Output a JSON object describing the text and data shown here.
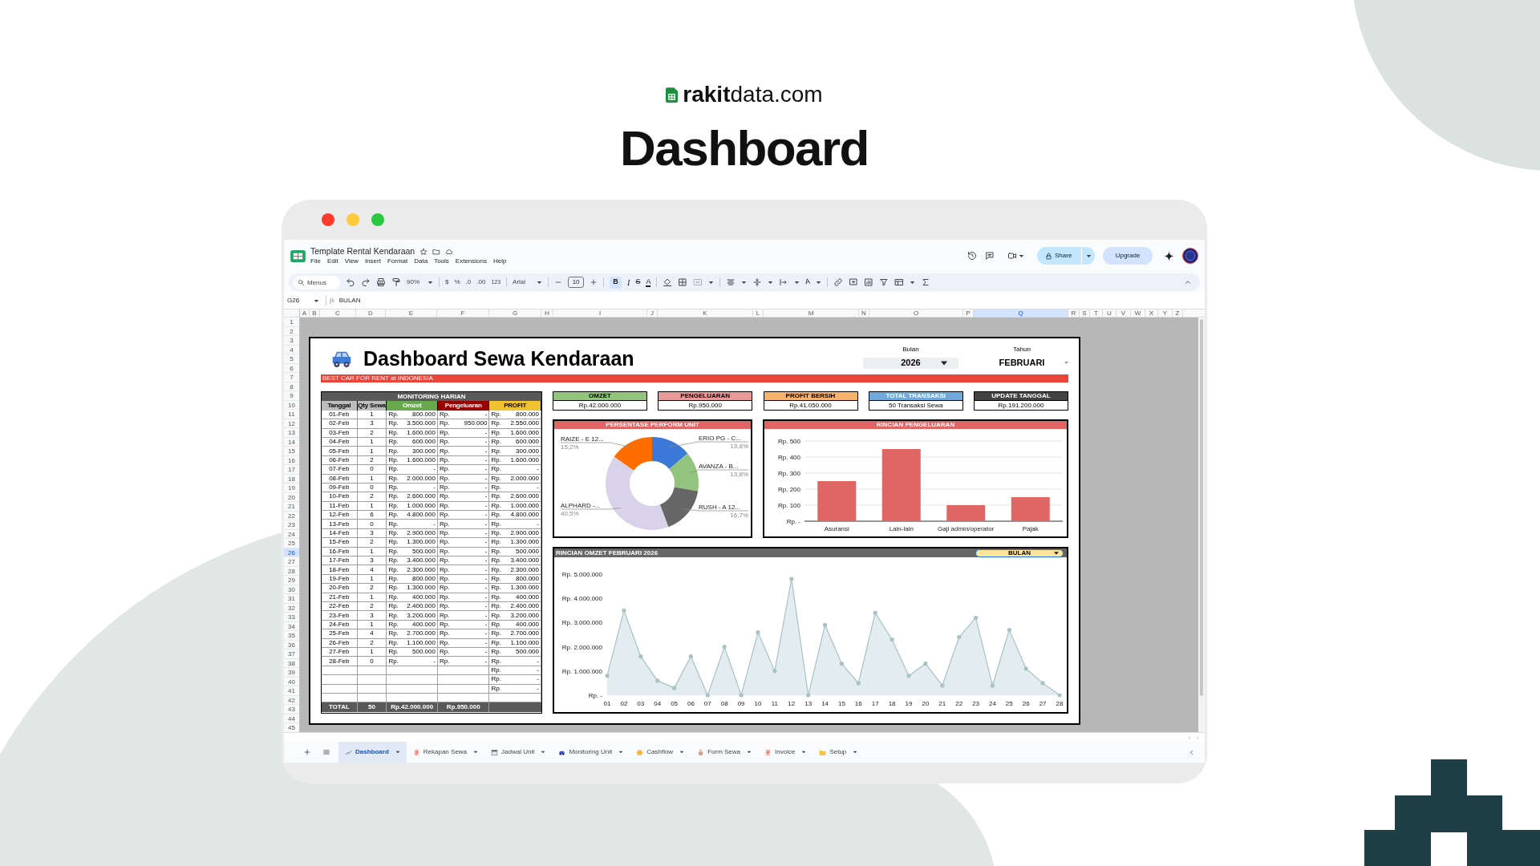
{
  "brand": "**rakit**data.com",
  "headline": "Dashboard",
  "sheets": {
    "doc_title": "Template Rental Kendaraan",
    "menu": [
      "File",
      "Edit",
      "View",
      "Insert",
      "Format",
      "Data",
      "Tools",
      "Extensions",
      "Help"
    ],
    "share": "Share",
    "upgrade": "Upgrade",
    "toolbar": {
      "search_placeholder": "Menus",
      "zoom": "90%",
      "currency": "$",
      "percent": "%",
      "decrease_decimals": ".0",
      "increase_decimals": ".00",
      "number_format": "123",
      "font": "Arial",
      "font_size": "10",
      "bold": "B",
      "bold_on": true,
      "italic": "I",
      "strike": "S",
      "text_color": "A",
      "rotate_text": "A"
    },
    "name_box": "G26",
    "fx": "fx",
    "formula": "BULAN",
    "columns": [
      {
        "label": "A",
        "selected": false
      },
      {
        "label": "B",
        "selected": false
      },
      {
        "label": "C",
        "selected": false
      },
      {
        "label": "D",
        "selected": false
      },
      {
        "label": "E",
        "selected": false
      },
      {
        "label": "F",
        "selected": false
      },
      {
        "label": "G",
        "selected": false
      },
      {
        "label": "H",
        "selected": false
      },
      {
        "label": "I",
        "selected": false
      },
      {
        "label": "J",
        "selected": false
      },
      {
        "label": "K",
        "selected": false
      },
      {
        "label": "L",
        "selected": false
      },
      {
        "label": "M",
        "selected": false
      },
      {
        "label": "N",
        "selected": false
      },
      {
        "label": "O",
        "selected": false
      },
      {
        "label": "P",
        "selected": false
      },
      {
        "label": "Q",
        "selected": true
      },
      {
        "label": "R",
        "selected": false
      },
      {
        "label": "S",
        "selected": false
      },
      {
        "label": "T",
        "selected": false
      },
      {
        "label": "U",
        "selected": false
      },
      {
        "label": "V",
        "selected": false
      },
      {
        "label": "W",
        "selected": false
      },
      {
        "label": "X",
        "selected": false
      },
      {
        "label": "Y",
        "selected": false
      },
      {
        "label": "Z",
        "selected": false
      }
    ],
    "rows": [
      {
        "label": "1",
        "selected": false
      },
      {
        "label": "2",
        "selected": false
      },
      {
        "label": "3",
        "selected": false
      },
      {
        "label": "4",
        "selected": false
      },
      {
        "label": "5",
        "selected": false
      },
      {
        "label": "6",
        "selected": false
      },
      {
        "label": "7",
        "selected": false
      },
      {
        "label": "8",
        "selected": false
      },
      {
        "label": "9",
        "selected": false
      },
      {
        "label": "10",
        "selected": false
      },
      {
        "label": "11",
        "selected": false
      },
      {
        "label": "12",
        "selected": false
      },
      {
        "label": "13",
        "selected": false
      },
      {
        "label": "14",
        "selected": false
      },
      {
        "label": "15",
        "selected": false
      },
      {
        "label": "16",
        "selected": false
      },
      {
        "label": "17",
        "selected": false
      },
      {
        "label": "18",
        "selected": false
      },
      {
        "label": "19",
        "selected": false
      },
      {
        "label": "20",
        "selected": false
      },
      {
        "label": "21",
        "selected": false
      },
      {
        "label": "22",
        "selected": false
      },
      {
        "label": "23",
        "selected": false
      },
      {
        "label": "24",
        "selected": false
      },
      {
        "label": "25",
        "selected": false
      },
      {
        "label": "26",
        "selected": true
      },
      {
        "label": "27",
        "selected": false
      },
      {
        "label": "28",
        "selected": false
      },
      {
        "label": "29",
        "selected": false
      },
      {
        "label": "30",
        "selected": false
      },
      {
        "label": "31",
        "selected": false
      },
      {
        "label": "32",
        "selected": false
      },
      {
        "label": "33",
        "selected": false
      },
      {
        "label": "34",
        "selected": false
      },
      {
        "label": "35",
        "selected": false
      },
      {
        "label": "36",
        "selected": false
      },
      {
        "label": "37",
        "selected": false
      },
      {
        "label": "38",
        "selected": false
      },
      {
        "label": "39",
        "selected": false
      },
      {
        "label": "40",
        "selected": false
      },
      {
        "label": "41",
        "selected": false
      },
      {
        "label": "42",
        "selected": false
      },
      {
        "label": "43",
        "selected": false
      },
      {
        "label": "44",
        "selected": false
      },
      {
        "label": "45",
        "selected": false
      }
    ],
    "tabs": [
      {
        "label": "Dashboard",
        "selected": true
      },
      {
        "label": "Rekapan Sewa",
        "selected": false
      },
      {
        "label": "Jadwal Unit",
        "selected": false
      },
      {
        "label": "Monitoring Unit",
        "selected": false
      },
      {
        "label": "Cashflow",
        "selected": false
      },
      {
        "label": "Form Sewa",
        "selected": false
      },
      {
        "label": "Invoice",
        "selected": false
      },
      {
        "label": "Setup",
        "selected": false
      }
    ]
  },
  "dashboard": {
    "title": "Dashboard Sewa Kendaraan",
    "tagline": "BEST CAR FOR RENT at INDONESIA",
    "year_label": "Bulan",
    "year": "2026",
    "month_label": "Tahun",
    "month": "FEBRUARI",
    "table": {
      "title": "MONITORING HARIAN",
      "columns": [
        {
          "label": "Tanggal",
          "color": "#bdbdbd"
        },
        {
          "label": "Qty Sewa",
          "color": "#bdbdbd"
        },
        {
          "label": "Omzet",
          "color": "#6aa84f"
        },
        {
          "label": "Pengeluaran",
          "color": "#990000"
        },
        {
          "label": "PROFIT",
          "color": "#f1c232"
        }
      ],
      "rows": [
        {
          "date": "01-Feb",
          "qty": "1",
          "omzet": [
            "Rp.",
            "800.000"
          ],
          "expense": [
            "Rp.",
            "-"
          ],
          "profit": [
            "Rp.",
            "800.000"
          ]
        },
        {
          "date": "02-Feb",
          "qty": "3",
          "omzet": [
            "Rp.",
            "3.500.000"
          ],
          "expense": [
            "Rp.",
            "950.000"
          ],
          "profit": [
            "Rp.",
            "2.550.000"
          ]
        },
        {
          "date": "03-Feb",
          "qty": "2",
          "omzet": [
            "Rp.",
            "1.600.000"
          ],
          "expense": [
            "Rp.",
            "-"
          ],
          "profit": [
            "Rp.",
            "1.600.000"
          ]
        },
        {
          "date": "04-Feb",
          "qty": "1",
          "omzet": [
            "Rp.",
            "600.000"
          ],
          "expense": [
            "Rp.",
            "-"
          ],
          "profit": [
            "Rp.",
            "600.000"
          ]
        },
        {
          "date": "05-Feb",
          "qty": "1",
          "omzet": [
            "Rp.",
            "300.000"
          ],
          "expense": [
            "Rp.",
            "-"
          ],
          "profit": [
            "Rp.",
            "300.000"
          ]
        },
        {
          "date": "06-Feb",
          "qty": "2",
          "omzet": [
            "Rp.",
            "1.600.000"
          ],
          "expense": [
            "Rp.",
            "-"
          ],
          "profit": [
            "Rp.",
            "1.600.000"
          ]
        },
        {
          "date": "07-Feb",
          "qty": "0",
          "omzet": [
            "Rp.",
            "-"
          ],
          "expense": [
            "Rp.",
            "-"
          ],
          "profit": [
            "Rp.",
            "-"
          ]
        },
        {
          "date": "08-Feb",
          "qty": "1",
          "omzet": [
            "Rp.",
            "2.000.000"
          ],
          "expense": [
            "Rp.",
            "-"
          ],
          "profit": [
            "Rp.",
            "2.000.000"
          ]
        },
        {
          "date": "09-Feb",
          "qty": "0",
          "omzet": [
            "Rp.",
            "-"
          ],
          "expense": [
            "Rp.",
            "-"
          ],
          "profit": [
            "Rp.",
            "-"
          ]
        },
        {
          "date": "10-Feb",
          "qty": "2",
          "omzet": [
            "Rp.",
            "2.600.000"
          ],
          "expense": [
            "Rp.",
            "-"
          ],
          "profit": [
            "Rp.",
            "2.600.000"
          ]
        },
        {
          "date": "11-Feb",
          "qty": "1",
          "omzet": [
            "Rp.",
            "1.000.000"
          ],
          "expense": [
            "Rp.",
            "-"
          ],
          "profit": [
            "Rp.",
            "1.000.000"
          ]
        },
        {
          "date": "12-Feb",
          "qty": "6",
          "omzet": [
            "Rp.",
            "4.800.000"
          ],
          "expense": [
            "Rp.",
            "-"
          ],
          "profit": [
            "Rp.",
            "4.800.000"
          ]
        },
        {
          "date": "13-Feb",
          "qty": "0",
          "omzet": [
            "Rp.",
            "-"
          ],
          "expense": [
            "Rp.",
            "-"
          ],
          "profit": [
            "Rp.",
            "-"
          ]
        },
        {
          "date": "14-Feb",
          "qty": "3",
          "omzet": [
            "Rp.",
            "2.900.000"
          ],
          "expense": [
            "Rp.",
            "-"
          ],
          "profit": [
            "Rp.",
            "2.900.000"
          ]
        },
        {
          "date": "15-Feb",
          "qty": "2",
          "omzet": [
            "Rp.",
            "1.300.000"
          ],
          "expense": [
            "Rp.",
            "-"
          ],
          "profit": [
            "Rp.",
            "1.300.000"
          ]
        },
        {
          "date": "16-Feb",
          "qty": "1",
          "omzet": [
            "Rp.",
            "500.000"
          ],
          "expense": [
            "Rp.",
            "-"
          ],
          "profit": [
            "Rp.",
            "500.000"
          ]
        },
        {
          "date": "17-Feb",
          "qty": "3",
          "omzet": [
            "Rp.",
            "3.400.000"
          ],
          "expense": [
            "Rp.",
            "-"
          ],
          "profit": [
            "Rp.",
            "3.400.000"
          ]
        },
        {
          "date": "18-Feb",
          "qty": "4",
          "omzet": [
            "Rp.",
            "2.300.000"
          ],
          "expense": [
            "Rp.",
            "-"
          ],
          "profit": [
            "Rp.",
            "2.300.000"
          ]
        },
        {
          "date": "19-Feb",
          "qty": "1",
          "omzet": [
            "Rp.",
            "800.000"
          ],
          "expense": [
            "Rp.",
            "-"
          ],
          "profit": [
            "Rp.",
            "800.000"
          ]
        },
        {
          "date": "20-Feb",
          "qty": "2",
          "omzet": [
            "Rp.",
            "1.300.000"
          ],
          "expense": [
            "Rp.",
            "-"
          ],
          "profit": [
            "Rp.",
            "1.300.000"
          ]
        },
        {
          "date": "21-Feb",
          "qty": "1",
          "omzet": [
            "Rp.",
            "400.000"
          ],
          "expense": [
            "Rp.",
            "-"
          ],
          "profit": [
            "Rp.",
            "400.000"
          ]
        },
        {
          "date": "22-Feb",
          "qty": "2",
          "omzet": [
            "Rp.",
            "2.400.000"
          ],
          "expense": [
            "Rp.",
            "-"
          ],
          "profit": [
            "Rp.",
            "2.400.000"
          ]
        },
        {
          "date": "23-Feb",
          "qty": "3",
          "omzet": [
            "Rp.",
            "3.200.000"
          ],
          "expense": [
            "Rp.",
            "-"
          ],
          "profit": [
            "Rp.",
            "3.200.000"
          ]
        },
        {
          "date": "24-Feb",
          "qty": "1",
          "omzet": [
            "Rp.",
            "400.000"
          ],
          "expense": [
            "Rp.",
            "-"
          ],
          "profit": [
            "Rp.",
            "400.000"
          ]
        },
        {
          "date": "25-Feb",
          "qty": "4",
          "omzet": [
            "Rp.",
            "2.700.000"
          ],
          "expense": [
            "Rp.",
            "-"
          ],
          "profit": [
            "Rp.",
            "2.700.000"
          ]
        },
        {
          "date": "26-Feb",
          "qty": "2",
          "omzet": [
            "Rp.",
            "1.100.000"
          ],
          "expense": [
            "Rp.",
            "-"
          ],
          "profit": [
            "Rp.",
            "1.100.000"
          ]
        },
        {
          "date": "27-Feb",
          "qty": "1",
          "omzet": [
            "Rp.",
            "500.000"
          ],
          "expense": [
            "Rp.",
            "-"
          ],
          "profit": [
            "Rp.",
            "500.000"
          ]
        },
        {
          "date": "28-Feb",
          "qty": "0",
          "omzet": [
            "Rp.",
            "-"
          ],
          "expense": [
            "Rp.",
            "-"
          ],
          "profit": [
            "Rp.",
            "-"
          ]
        },
        {
          "profit": [
            "Rp.",
            "-"
          ]
        },
        {
          "profit": [
            "Rp.",
            "-"
          ]
        },
        {
          "profit": [
            "Rp.",
            "-"
          ]
        }
      ],
      "total": {
        "label": "TOTAL",
        "qty": "50",
        "omzet": "Rp.42.000.000",
        "expense": "Rp.950.000"
      }
    },
    "kpis": [
      {
        "label": "OMZET",
        "value": "Rp.42.000.000",
        "color": "#93c47d"
      },
      {
        "label": "PENGELUARAN",
        "value": "Rp.950.000",
        "color": "#ea9999"
      },
      {
        "label": "PROFIT BERSIH",
        "value": "Rp.41.050.000",
        "color": "#f6b26b"
      },
      {
        "label": "TOTAL TRANSAKSI",
        "value": "50 Transaksi Sewa",
        "color": "#6fa8dc"
      },
      {
        "label": "UPDATE TANGGAL",
        "value": "Rp.191.200.000",
        "color": "#434343"
      }
    ],
    "unit_chart": {
      "title": "PERSENTASE PERFORM UNIT",
      "chart_data": {
        "type": "donut",
        "categories": [
          "ERIO PG - C...",
          "AVANZA - B...",
          "RUSH - A 12...",
          "ALPHARD -...",
          "RAIZE - E 12..."
        ],
        "values": [
          13.8,
          13.8,
          16.7,
          40.5,
          15.2
        ],
        "value_labels": [
          "13,8%",
          "13,8%",
          "16,7%",
          "40,5%",
          "15,2%"
        ]
      }
    },
    "expense_chart": {
      "title": "RINCIAN PENGELUARAN",
      "chart_data": {
        "type": "bar",
        "categories": [
          "Asuransi",
          "Lain-lain",
          "Gaji admin/operator",
          "Pajak"
        ],
        "values": [
          250,
          450,
          100,
          150
        ],
        "grid": true,
        "ylim": [
          0,
          500
        ],
        "yticks": [
          {
            "value": 0,
            "label": "Rp. -"
          },
          {
            "value": 100,
            "label": "Rp. 100"
          },
          {
            "value": 200,
            "label": "Rp. 200"
          },
          {
            "value": 300,
            "label": "Rp. 300"
          },
          {
            "value": 400,
            "label": "Rp. 400"
          },
          {
            "value": 500,
            "label": "Rp. 500"
          }
        ]
      }
    },
    "omzet_chart": {
      "title": "RINCIAN OMZET FEBRUARI 2026",
      "filter": "BULAN",
      "chart_data": {
        "type": "area",
        "categories": [
          "01",
          "02",
          "03",
          "04",
          "05",
          "06",
          "07",
          "08",
          "09",
          "10",
          "11",
          "12",
          "13",
          "14",
          "15",
          "16",
          "17",
          "18",
          "19",
          "20",
          "21",
          "22",
          "23",
          "24",
          "25",
          "26",
          "27",
          "28"
        ],
        "values": [
          800000,
          3500000,
          1600000,
          600000,
          300000,
          1600000,
          0,
          2000000,
          0,
          2600000,
          1000000,
          4800000,
          0,
          2900000,
          1300000,
          500000,
          3400000,
          2300000,
          800000,
          1300000,
          400000,
          2400000,
          3200000,
          400000,
          2700000,
          1100000,
          500000,
          0
        ],
        "ylim": [
          0,
          5000000
        ],
        "yticks": [
          {
            "value": 0,
            "label": "Rp. -"
          },
          {
            "value": 1000000,
            "label": "Rp. 1.000.000"
          },
          {
            "value": 2000000,
            "label": "Rp. 2.000.000"
          },
          {
            "value": 3000000,
            "label": "Rp. 3.000.000"
          },
          {
            "value": 4000000,
            "label": "Rp. 4.000.000"
          },
          {
            "value": 5000000,
            "label": "Rp. 5.000.000"
          }
        ]
      }
    }
  }
}
